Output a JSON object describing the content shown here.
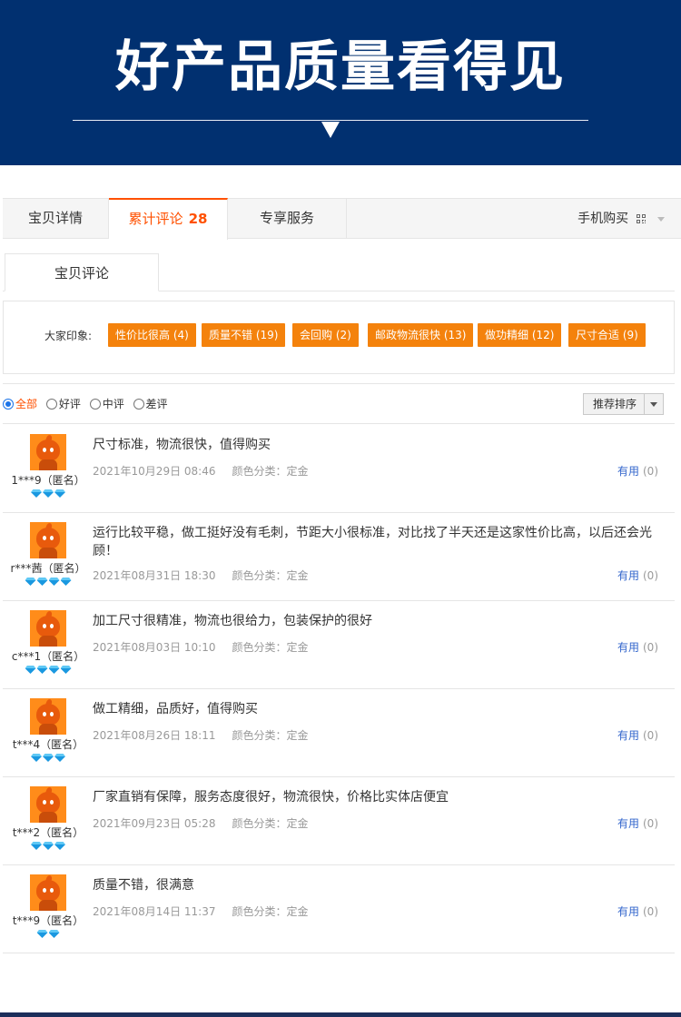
{
  "banner": {
    "title": "好产品质量看得见"
  },
  "tabs": [
    {
      "label": "宝贝详情"
    },
    {
      "label": "累计评论",
      "count": "28"
    },
    {
      "label": "专享服务"
    }
  ],
  "mobile_buy": {
    "label": "手机购买",
    "icon": "qr-code-icon"
  },
  "subtab": {
    "label": "宝贝评论"
  },
  "impressions": {
    "label": "大家印象:",
    "tags": [
      "性价比很高 (4)",
      "质量不错 (19)",
      "会回购 (2)",
      "邮政物流很快 (13)",
      "做功精细 (12)",
      "尺寸合适 (9)"
    ]
  },
  "filter": {
    "options": [
      "全部",
      "好评",
      "中评",
      "差评"
    ],
    "selected": "全部",
    "sort_label": "推荐排序"
  },
  "reviews": [
    {
      "user": "1***9（匿名）",
      "level": 3,
      "text": "尺寸标准，物流很快，值得购买",
      "date": "2021年10月29日 08:46",
      "sku": "颜色分类：定金",
      "useful": "有用",
      "useful_count": "(0)"
    },
    {
      "user": "r***茜（匿名）",
      "level": 4,
      "text": "运行比较平稳，做工挺好没有毛刺，节距大小很标准，对比找了半天还是这家性价比高，以后还会光顾！",
      "date": "2021年08月31日 18:30",
      "sku": "颜色分类：定金",
      "useful": "有用",
      "useful_count": "(0)"
    },
    {
      "user": "c***1（匿名）",
      "level": 4,
      "text": "加工尺寸很精准，物流也很给力，包装保护的很好",
      "date": "2021年08月03日 10:10",
      "sku": "颜色分类：定金",
      "useful": "有用",
      "useful_count": "(0)"
    },
    {
      "user": "t***4（匿名）",
      "level": 3,
      "text": "做工精细，品质好，值得购买",
      "date": "2021年08月26日 18:11",
      "sku": "颜色分类：定金",
      "useful": "有用",
      "useful_count": "(0)"
    },
    {
      "user": "t***2（匿名）",
      "level": 3,
      "text": "厂家直销有保障，服务态度很好，物流很快，价格比实体店便宜",
      "date": "2021年09月23日 05:28",
      "sku": "颜色分类：定金",
      "useful": "有用",
      "useful_count": "(0)"
    },
    {
      "user": "t***9（匿名）",
      "level": 2,
      "text": "质量不错，很满意",
      "date": "2021年08月14日 11:37",
      "sku": "颜色分类：定金",
      "useful": "有用",
      "useful_count": "(0)"
    }
  ],
  "colors": {
    "banner": "#013070",
    "accent": "#ff5000",
    "tag": "#f4820c",
    "link": "#3366cc"
  }
}
